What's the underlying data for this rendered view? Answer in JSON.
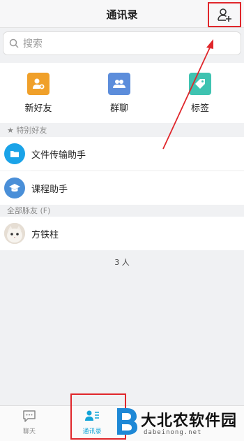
{
  "header": {
    "title": "通讯录"
  },
  "search": {
    "placeholder": "搜索"
  },
  "quick_actions": [
    {
      "label": "新好友",
      "icon": "new-friend-icon",
      "color": "#f0a02a"
    },
    {
      "label": "群聊",
      "icon": "group-chat-icon",
      "color": "#5c8ddb"
    },
    {
      "label": "标签",
      "icon": "tag-icon",
      "color": "#3fc3b1"
    }
  ],
  "special_friends": {
    "header": "★ 特别好友",
    "items": [
      {
        "name": "文件传输助手",
        "icon": "folder-icon",
        "color": "#1aa3e8"
      },
      {
        "name": "课程助手",
        "icon": "graduation-cap-icon",
        "color": "#4a8fd8"
      }
    ]
  },
  "all_contacts": {
    "header": "全部脉友 (F)",
    "items": [
      {
        "name": "方铁柱"
      }
    ]
  },
  "count_label": "3 人",
  "tabbar": {
    "tabs": [
      {
        "label": "聊天",
        "icon": "chat-icon",
        "active": false
      },
      {
        "label": "通讯录",
        "icon": "contacts-icon",
        "active": true
      }
    ]
  },
  "watermark": {
    "text": "大北农软件园",
    "sub": "dabeinong.net"
  },
  "colors": {
    "accent": "#12a4d8",
    "annotation_red": "#e0262b"
  }
}
